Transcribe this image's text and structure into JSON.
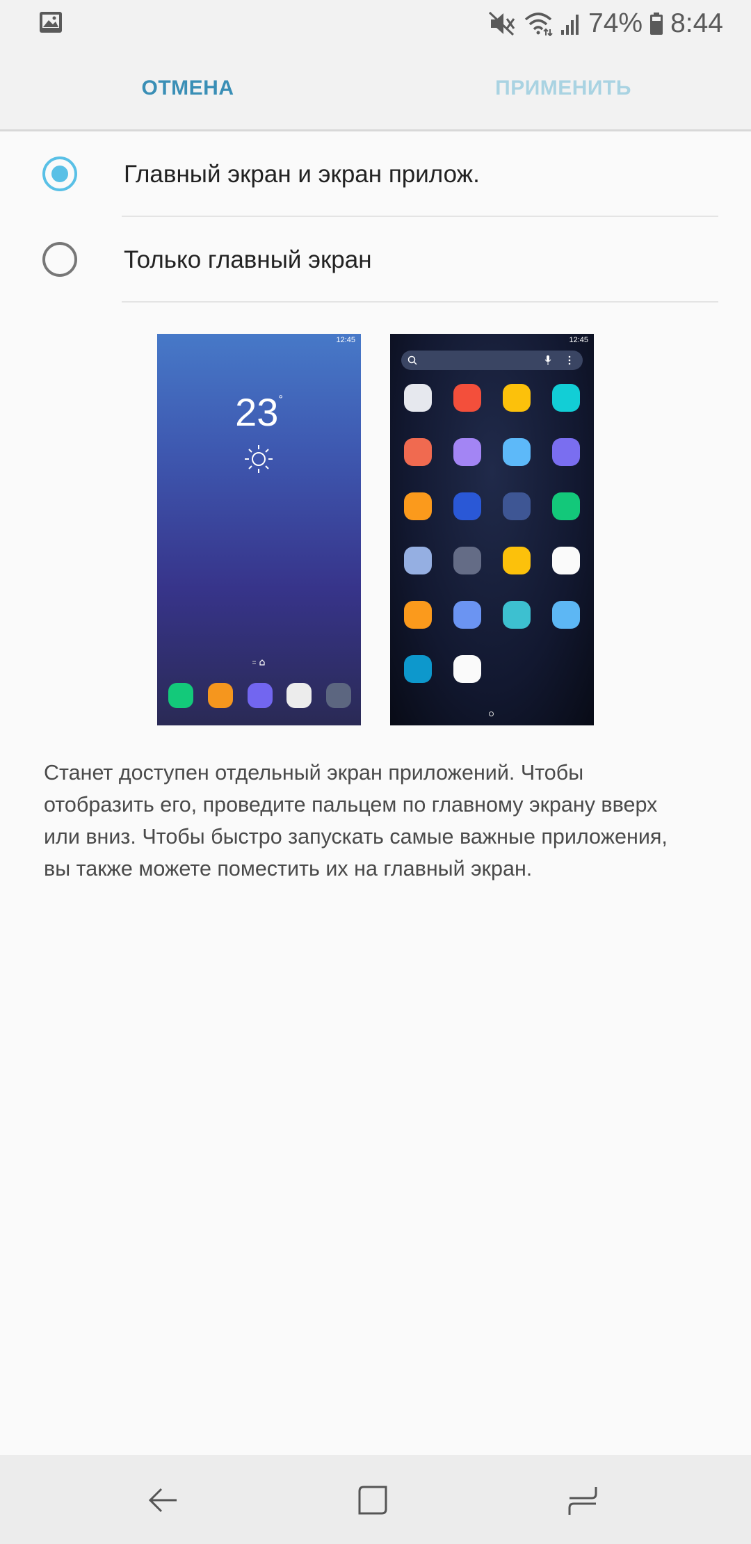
{
  "status_bar": {
    "battery": "74%",
    "time": "8:44",
    "icons": [
      "gallery-icon",
      "mute-icon",
      "wifi-icon",
      "signal-icon",
      "battery-icon"
    ]
  },
  "action_bar": {
    "cancel_label": "ОТМЕНА",
    "apply_label": "ПРИМЕНИТЬ",
    "accent_color": "#3a8fb6",
    "disabled_color": "#a9d3e2"
  },
  "options": [
    {
      "label": "Главный экран и экран прилож.",
      "selected": true
    },
    {
      "label": "Только главный экран",
      "selected": false
    }
  ],
  "preview": {
    "home_time": "12:45",
    "home_temperature": "23",
    "home_degree": "°",
    "apps_time": "12:45",
    "dock_colors": [
      "#13c97a",
      "#f5961e",
      "#7266f0",
      "#ececec",
      "#5c6680"
    ],
    "app_colors": [
      "#e6e8ee",
      "#f34f3b",
      "#fcc10b",
      "#12ced6",
      "#f06a50",
      "#a385f4",
      "#5db9f9",
      "#7a6ef0",
      "#fb9a1c",
      "#2a58d6",
      "#3e5694",
      "#13c87a",
      "#95afe2",
      "#646c86",
      "#fcc10b",
      "#fafafa",
      "#fb9a1c",
      "#6b94f2",
      "#3dc0d0",
      "#5db7f4",
      "#0d98cc",
      "#fafafa"
    ]
  },
  "description": "Станет доступен отдельный экран приложений. Чтобы отобразить его, проведите пальцем по главному экрану вверх или вниз. Чтобы быстро запускать самые важные приложения, вы также можете поместить их на главный экран.",
  "nav_bar": {
    "icons": [
      "back-icon",
      "home-icon",
      "recents-icon"
    ]
  }
}
